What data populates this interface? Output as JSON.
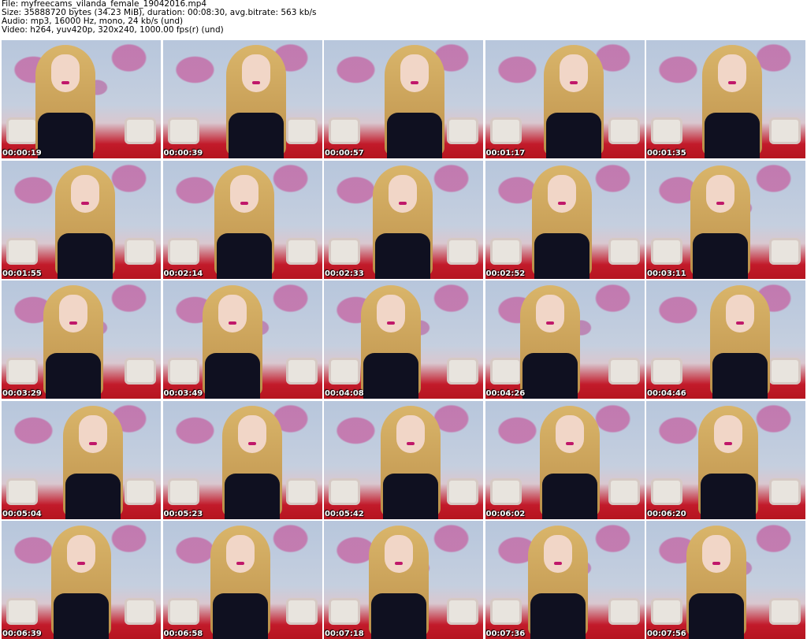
{
  "header": {
    "file": "File: myfreecams_vilanda_female_19042016.mp4",
    "size": "Size: 35888720 bytes (34.23 MiB), duration: 00:08:30, avg.bitrate: 563 kb/s",
    "audio": "Audio: mp3, 16000 Hz, mono, 24 kb/s (und)",
    "video": "Video: h264, yuv420p, 320x240, 1000.00 fps(r) (und)"
  },
  "thumbnails": [
    {
      "time": "00:00:19"
    },
    {
      "time": "00:00:39"
    },
    {
      "time": "00:00:57"
    },
    {
      "time": "00:01:17"
    },
    {
      "time": "00:01:35"
    },
    {
      "time": "00:01:55"
    },
    {
      "time": "00:02:14"
    },
    {
      "time": "00:02:33"
    },
    {
      "time": "00:02:52"
    },
    {
      "time": "00:03:11"
    },
    {
      "time": "00:03:29"
    },
    {
      "time": "00:03:49"
    },
    {
      "time": "00:04:08"
    },
    {
      "time": "00:04:26"
    },
    {
      "time": "00:04:46"
    },
    {
      "time": "00:05:04"
    },
    {
      "time": "00:05:23"
    },
    {
      "time": "00:05:42"
    },
    {
      "time": "00:06:02"
    },
    {
      "time": "00:06:20"
    },
    {
      "time": "00:06:39"
    },
    {
      "time": "00:06:58"
    },
    {
      "time": "00:07:18"
    },
    {
      "time": "00:07:36"
    },
    {
      "time": "00:07:56"
    }
  ]
}
